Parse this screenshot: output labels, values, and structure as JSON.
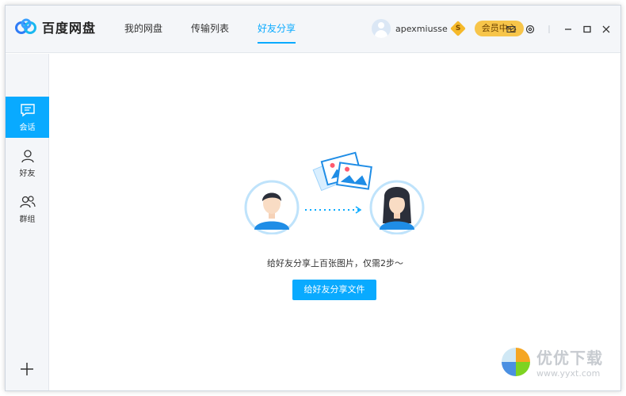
{
  "app": {
    "title": "百度网盘"
  },
  "nav": {
    "tabs": [
      {
        "label": "我的网盘",
        "active": false
      },
      {
        "label": "传输列表",
        "active": false
      },
      {
        "label": "好友分享",
        "active": true
      }
    ]
  },
  "user": {
    "name": "apexmiusse",
    "vip_badge": "S",
    "member_center_label": "会员中心"
  },
  "sidebar": {
    "items": [
      {
        "label": "会话",
        "icon": "chat-icon",
        "active": true
      },
      {
        "label": "好友",
        "icon": "person-icon",
        "active": false
      },
      {
        "label": "群组",
        "icon": "group-icon",
        "active": false
      }
    ]
  },
  "main": {
    "prompt_text": "给好友分享上百张图片，仅需2步～",
    "share_button_label": "给好友分享文件"
  },
  "watermark": {
    "title": "优优下载",
    "url": "www.yyxt.com"
  },
  "colors": {
    "accent": "#09aaff",
    "gold": "#f7c54a",
    "sidebar_bg": "#f4f6f9"
  }
}
